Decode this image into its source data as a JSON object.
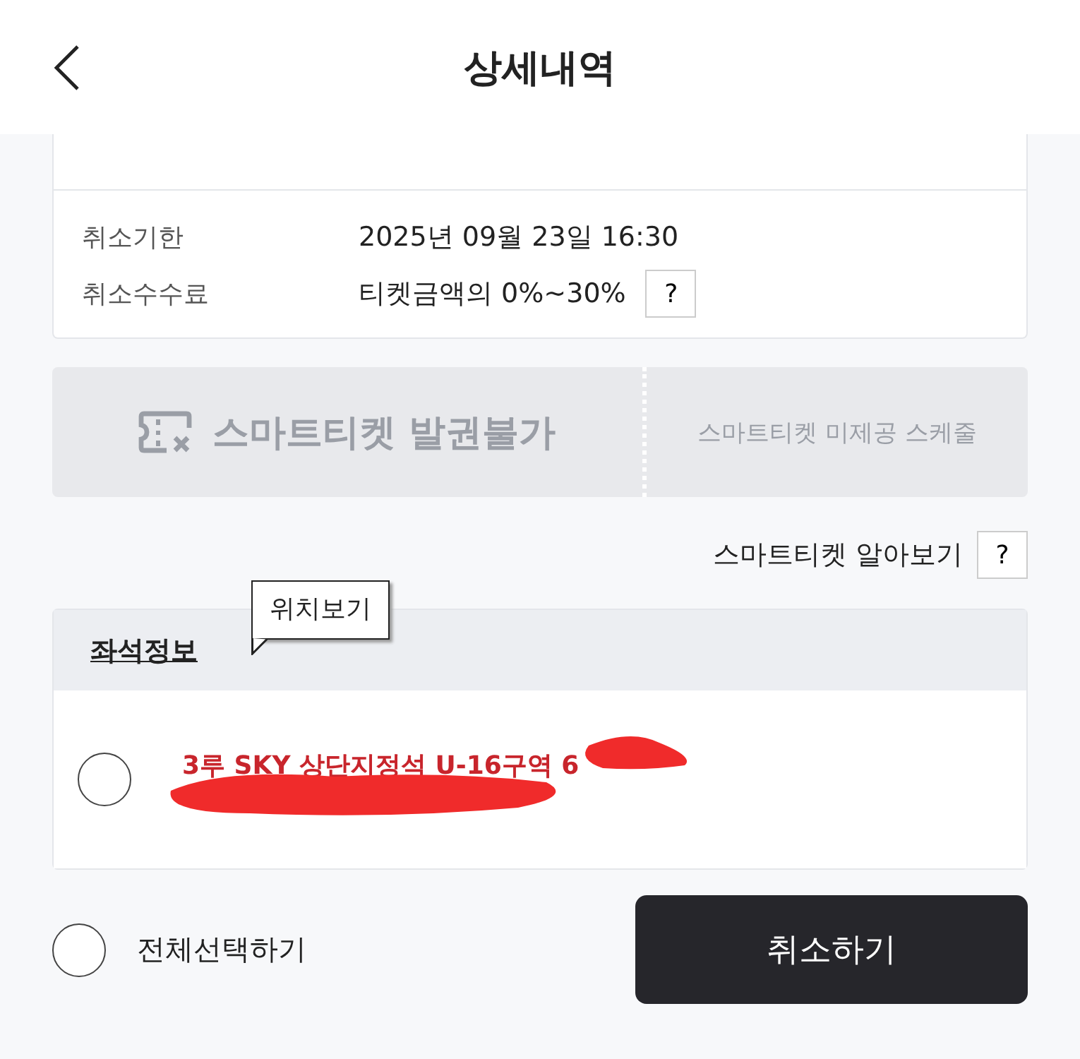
{
  "header": {
    "title": "상세내역"
  },
  "cancel_info": [
    {
      "label": "취소기한",
      "value": "2025년 09월 23일 16:30",
      "help": false
    },
    {
      "label": "취소수수료",
      "value": "티켓금액의 0%~30%",
      "help": true,
      "help_label": "?"
    }
  ],
  "smart_ticket": {
    "status": "스마트티켓 발권불가",
    "note": "스마트티켓 미제공 스케줄",
    "disabled": true
  },
  "smart_ticket_help": {
    "label": "스마트티켓 알아보기",
    "help_label": "?"
  },
  "seats": {
    "title": "좌석정보",
    "tooltip": "위치보기",
    "items": [
      {
        "text": "3루 SKY 상단지정석 U-16구역 6",
        "selected": false,
        "redacted": true
      }
    ]
  },
  "footer": {
    "select_all": {
      "label": "전체선택하기",
      "selected": false
    },
    "cancel_button": "취소하기"
  }
}
